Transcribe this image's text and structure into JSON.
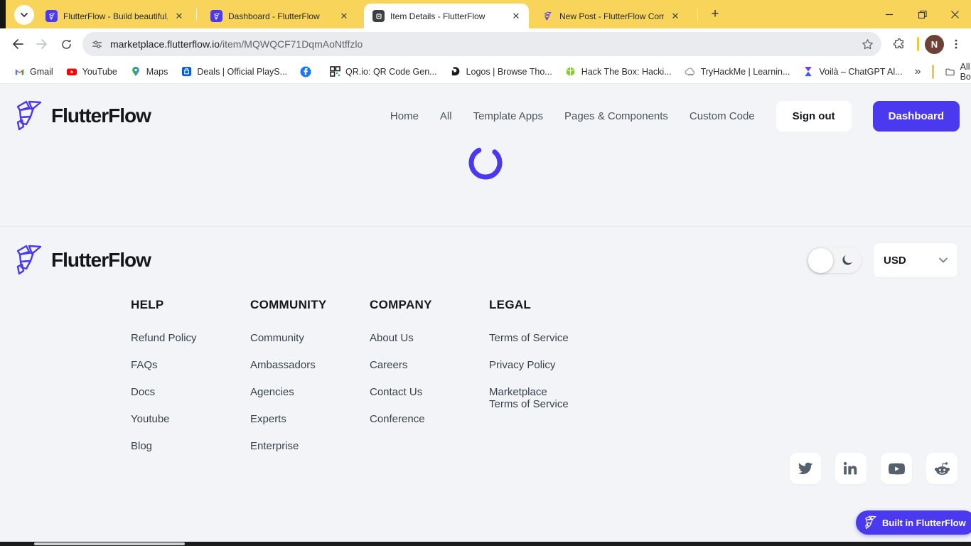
{
  "browser": {
    "tabs": [
      {
        "title": "FlutterFlow - Build beautiful, mo",
        "active": false
      },
      {
        "title": "Dashboard - FlutterFlow",
        "active": false
      },
      {
        "title": "Item Details - FlutterFlow",
        "active": true
      },
      {
        "title": "New Post - FlutterFlow Commu",
        "active": false
      }
    ],
    "url_host": "marketplace.flutterflow.io",
    "url_path": "/item/MQWQCF71DqmAoNtffzlo",
    "avatar_initial": "N",
    "bookmarks": [
      {
        "label": "Gmail"
      },
      {
        "label": "YouTube"
      },
      {
        "label": "Maps"
      },
      {
        "label": "Deals | Official PlayS..."
      },
      {
        "label": ""
      },
      {
        "label": "QR.io: QR Code Gen..."
      },
      {
        "label": "Logos | Browse Tho..."
      },
      {
        "label": "Hack The Box: Hacki..."
      },
      {
        "label": "TryHackMe | Learnin..."
      },
      {
        "label": "Voilà – ChatGPT Al..."
      }
    ],
    "all_bookmarks_label": "All Bookmarks"
  },
  "header": {
    "brand": "FlutterFlow",
    "nav": [
      "Home",
      "All",
      "Template Apps",
      "Pages & Components",
      "Custom Code"
    ],
    "signout_label": "Sign out",
    "dashboard_label": "Dashboard"
  },
  "footer": {
    "brand": "FlutterFlow",
    "currency": "USD",
    "columns": [
      {
        "title": "HELP",
        "links": [
          "Refund Policy",
          "FAQs",
          "Docs",
          "Youtube",
          "Blog"
        ]
      },
      {
        "title": "COMMUNITY",
        "links": [
          "Community",
          "Ambassadors",
          "Agencies",
          "Experts",
          "Enterprise"
        ]
      },
      {
        "title": "COMPANY",
        "links": [
          "About Us",
          "Careers",
          "Contact Us",
          "Conference"
        ]
      },
      {
        "title": "LEGAL",
        "links": [
          "Terms of Service",
          "Privacy Policy",
          "Marketplace Terms of Service"
        ]
      }
    ],
    "socials": [
      "twitter",
      "linkedin",
      "youtube",
      "reddit"
    ],
    "badge_label": "Built in FlutterFlow"
  },
  "colors": {
    "accent_purple": "#4B39EF",
    "theme_yellow": "#F8D45A",
    "page_background": "#F2F4F7",
    "icon_slate": "#54616C"
  }
}
